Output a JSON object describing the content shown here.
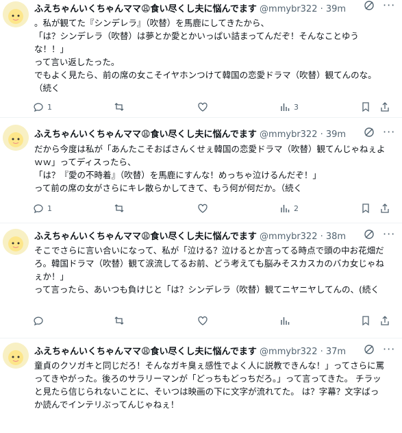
{
  "tweets": [
    {
      "name": "ふえちゃんいくちゃんママ😩食い尽くし夫に悩んでます",
      "handle": "@mmybr322",
      "time": "· 39m",
      "text": "。私が観てた『シンデレラ』（吹替）を馬鹿にしてきたから、\n「は？シンデレラ（吹替）は夢とか愛とかいっぱい詰まってんだぞ！そんなことゆうな！！」\nって言い返したった。\nでもよく見たら、前の席の女こそイヤホンつけて韓国の恋愛ドラマ（吹替）観てんのな。（続く",
      "replies": "1",
      "views": "3"
    },
    {
      "name": "ふえちゃんいくちゃんママ😩食い尽くし夫に悩んでます",
      "handle": "@mmybr322",
      "time": "· 39m",
      "text": "だから今度は私が「あんたこそおばさんくせぇ韓国の恋愛ドラマ（吹替）観てんじゃねぇよｗｗ」ってディスったら、\n「は？『愛の不時着』（吹替）を馬鹿にすんな！めっちゃ泣けるんだぞ！」\nって前の席の女がさらにキレ散らかしてきて、もう何が何だか。（続く",
      "replies": "1",
      "views": "2"
    },
    {
      "name": "ふえちゃんいくちゃんママ😩食い尽くし夫に悩んでます",
      "handle": "@mmybr322",
      "time": "· 38m",
      "text": "そこでさらに言い合いになって、私が「泣ける？泣けるとか言ってる時点で頭の中お花畑だろ。韓国ドラマ（吹替）観て涙流してるお前、どう考えても脳みそスカスカのバカ女じゃねぇか！」\nって言ったら、あいつも負けじと「は？シンデレラ（吹替）観てニヤニヤしてんの、(続く",
      "replies": "",
      "views": ""
    },
    {
      "name": "ふえちゃんいくちゃんママ😩食い尽くし夫に悩んでます",
      "handle": "@mmybr322",
      "time": "· 37m",
      "text": "童貞のクソガキと同じだろ！そんなガキ臭ぇ感性でよく人に説教できんな！」ってさらに罵ってきやがった。後ろのサラリーマンが「どっちもどっちだろ。」って言ってきた。 チラッと見たら信じられないことに、そいつは映画の下に文字が流れてた。 は？字幕？文字ばっか読んでインテリぶってんじゃねぇ！",
      "replies": "",
      "views": ""
    }
  ]
}
